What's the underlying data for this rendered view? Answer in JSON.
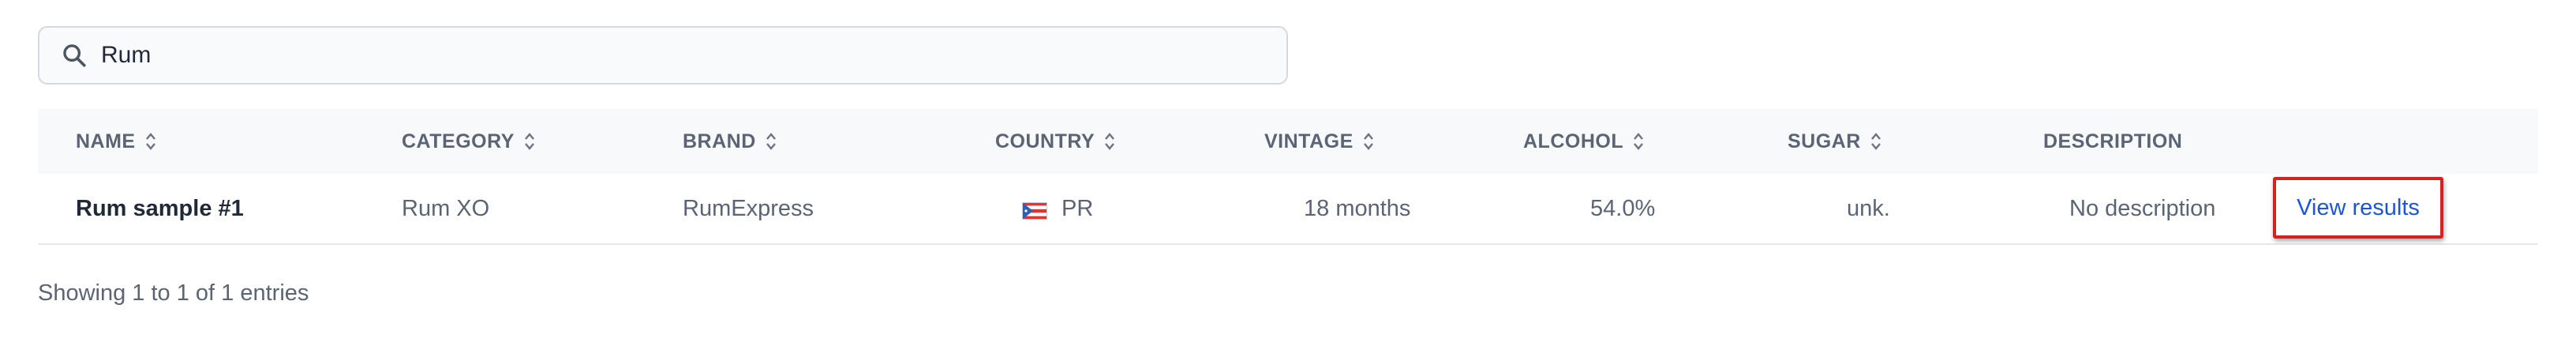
{
  "search": {
    "value": "Rum",
    "icon": "search-icon"
  },
  "table": {
    "columns": [
      {
        "label": "NAME",
        "sortable": true
      },
      {
        "label": "CATEGORY",
        "sortable": true
      },
      {
        "label": "BRAND",
        "sortable": true
      },
      {
        "label": "COUNTRY",
        "sortable": true
      },
      {
        "label": "VINTAGE",
        "sortable": true
      },
      {
        "label": "ALCOHOL",
        "sortable": true
      },
      {
        "label": "SUGAR",
        "sortable": true
      },
      {
        "label": "DESCRIPTION",
        "sortable": false
      }
    ],
    "rows": [
      {
        "name": "Rum sample #1",
        "category": "Rum XO",
        "brand": "RumExpress",
        "country": "PR",
        "country_flag": "puerto-rico-flag-icon",
        "vintage": "18 months",
        "alcohol": "54.0%",
        "sugar": "unk.",
        "description": "No description",
        "action": "View results"
      }
    ]
  },
  "footer": {
    "summary": "Showing 1 to 1 of 1 entries"
  },
  "colors": {
    "link": "#1a56db",
    "highlight_border": "#d92020",
    "header_bg": "#f8f9fb",
    "text_muted": "#5b6474"
  }
}
